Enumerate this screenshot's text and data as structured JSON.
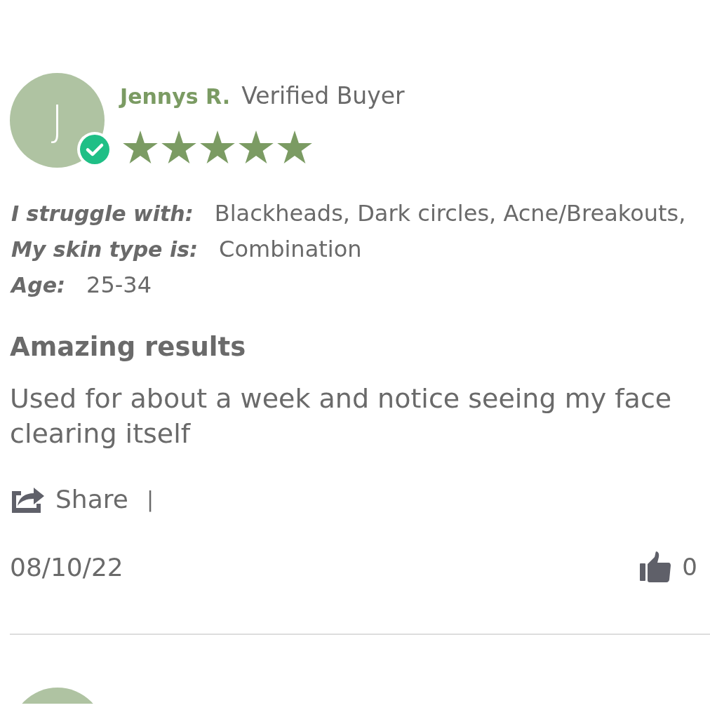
{
  "reviews": [
    {
      "avatar_initial": "J",
      "verified": true,
      "name": "Jennys R.",
      "buyer_label": "Verified Buyer",
      "stars": 5,
      "attributes": [
        {
          "label": "I struggle with:",
          "value": "Blackheads, Dark circles, Acne/Breakouts,"
        },
        {
          "label": "My skin type is:",
          "value": "Combination"
        },
        {
          "label": "Age:",
          "value": "25-34"
        }
      ],
      "title": "Amazing results",
      "body": "Used for about a week and notice seeing my face clearing itself",
      "share": "Share",
      "separator": "|",
      "date": "08/10/22",
      "helpful_count": "0"
    }
  ]
}
